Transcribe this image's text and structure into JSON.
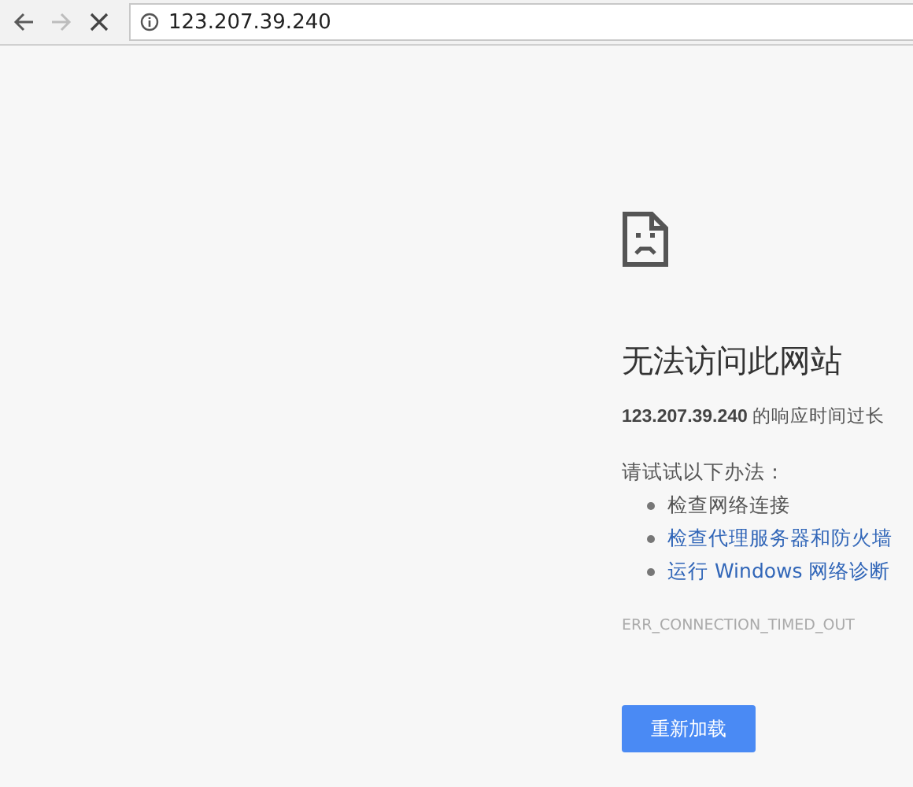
{
  "toolbar": {
    "back": {
      "disabled": false
    },
    "forward": {
      "disabled": true
    },
    "address": "123.207.39.240"
  },
  "error": {
    "title": "无法访问此网站",
    "message": "**123.207.39.240** 的响应时间过长",
    "suggestions_heading": "请试试以下办法：",
    "suggestions": [
      {
        "kind": "text",
        "label": "检查网络连接"
      },
      {
        "kind": "link",
        "label": "检查代理服务器和防火墙"
      },
      {
        "kind": "link",
        "label": "运行 Windows 网络诊断"
      }
    ],
    "code": "ERR_CONNECTION_TIMED_OUT",
    "reload_button": "重新加载"
  }
}
